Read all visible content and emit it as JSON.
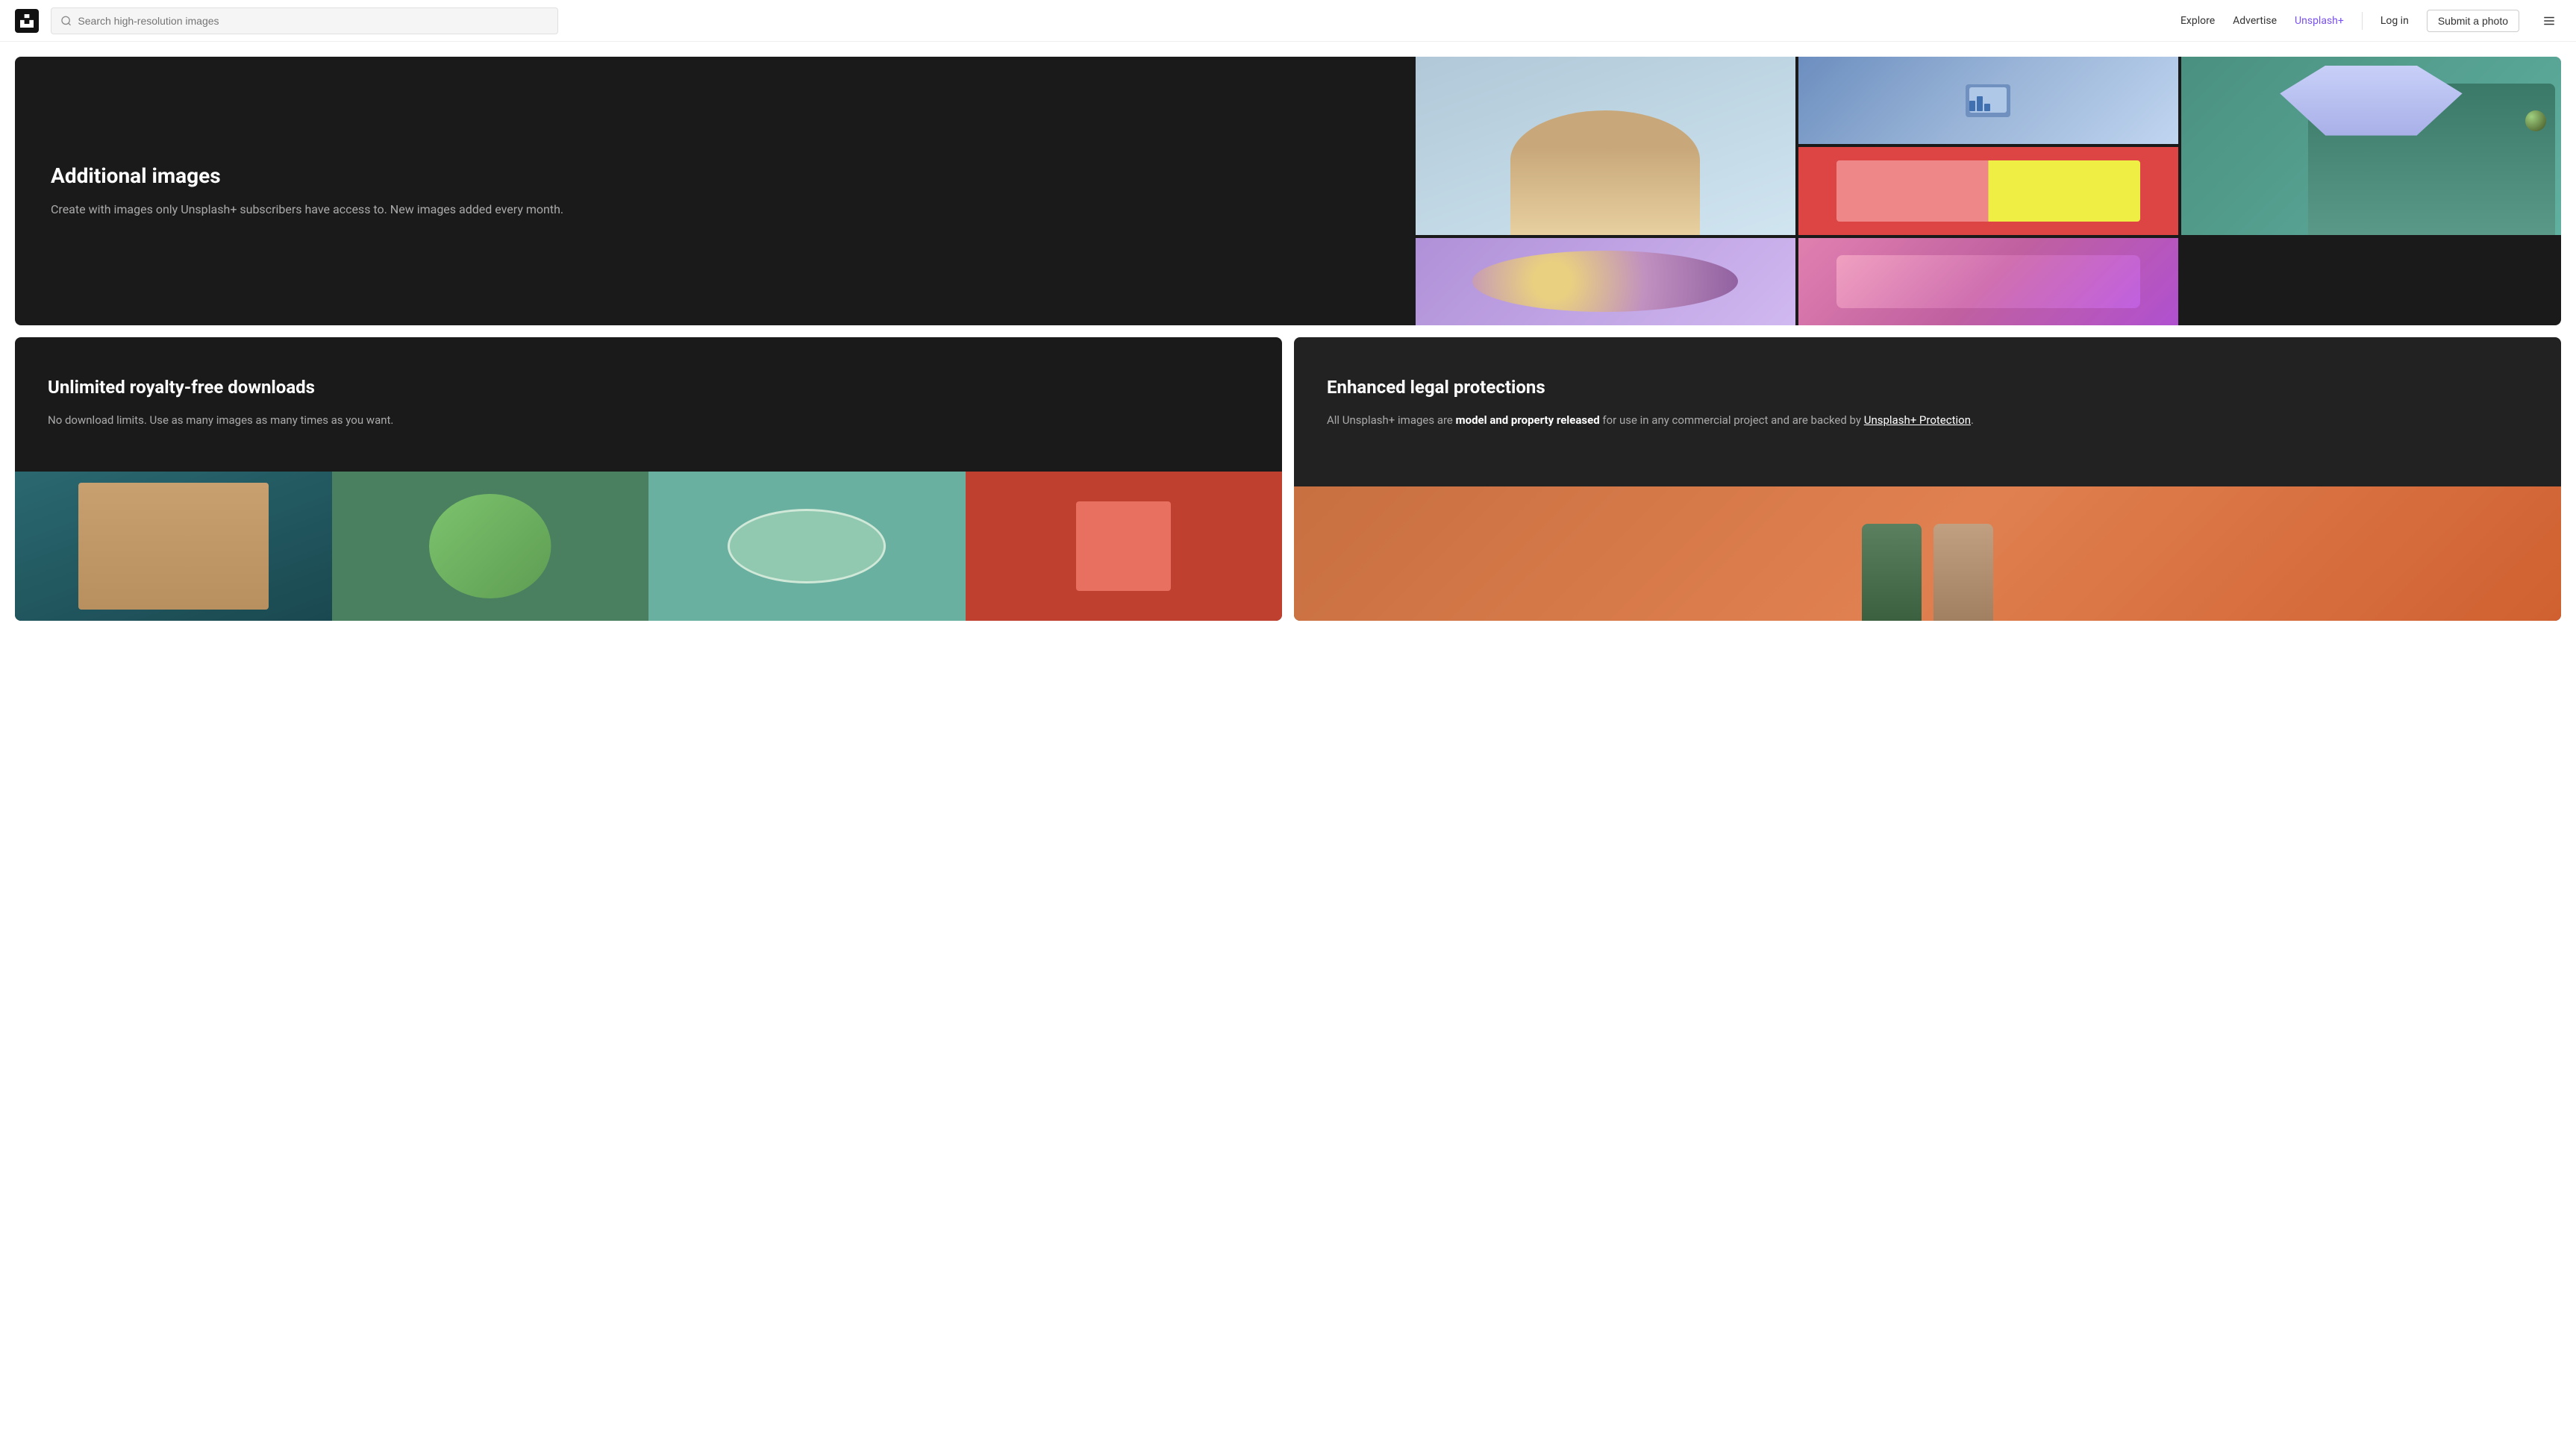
{
  "nav": {
    "logo_alt": "Unsplash logo",
    "search_placeholder": "Search high-resolution images",
    "links": [
      {
        "id": "explore",
        "label": "Explore"
      },
      {
        "id": "advertise",
        "label": "Advertise"
      },
      {
        "id": "unsplash-plus",
        "label": "Unsplash+",
        "accent": true
      }
    ],
    "login_label": "Log in",
    "submit_label": "Submit a photo"
  },
  "additional_images": {
    "title": "Additional images",
    "description": "Create with images only Unsplash+ subscribers have access to. New images added every month."
  },
  "downloads": {
    "title": "Unlimited royalty-free downloads",
    "description": "No download limits. Use as many images as many times as you want."
  },
  "legal": {
    "title": "Enhanced legal protections",
    "description_plain1": "All Unsplash+ images are ",
    "description_bold": "model and property released",
    "description_plain2": " for use in any commercial project and are backed by ",
    "description_link": "Unsplash+ Protection",
    "description_end": "."
  }
}
